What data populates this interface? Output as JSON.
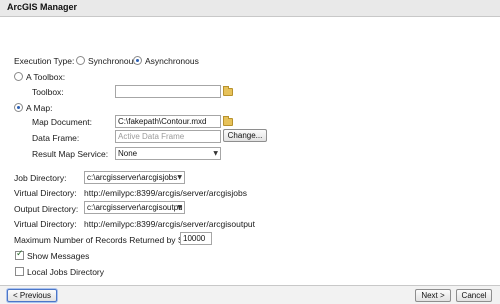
{
  "window": {
    "title": "ArcGIS Manager"
  },
  "execution": {
    "label": "Execution Type:",
    "options": [
      {
        "label": "Synchronous",
        "selected": false
      },
      {
        "label": "Asynchronous",
        "selected": true
      }
    ]
  },
  "toolbox": {
    "radio_label": "A Toolbox:",
    "field_label": "Toolbox:",
    "value": "",
    "selected": false
  },
  "map": {
    "radio_label": "A Map:",
    "selected": true,
    "document_label": "Map Document:",
    "document_value": "C:\\fakepath\\Contour.mxd",
    "data_frame_label": "Data Frame:",
    "data_frame_placeholder": "Active Data Frame",
    "change_button": "Change...",
    "result_service_label": "Result Map Service:",
    "result_service_value": "None"
  },
  "jobs": {
    "job_dir_label": "Job Directory:",
    "job_dir_value": "c:\\arcgisserver\\arcgisjobs",
    "virtual_dir_label": "Virtual Directory:",
    "virtual_dir_value": "http://emilypc:8399/arcgis/server/arcgisjobs",
    "output_dir_label": "Output Directory:",
    "output_dir_value": "c:\\arcgisserver\\arcgisoutpu",
    "output_virtual_label": "Virtual Directory:",
    "output_virtual_value": "http://emilypc:8399/arcgis/server/arcgisoutput"
  },
  "records": {
    "label": "Maximum Number of Records Returned by Server:",
    "value": "10000"
  },
  "options": {
    "show_messages": {
      "label": "Show Messages",
      "checked": true
    },
    "local_jobs": {
      "label": "Local Jobs Directory",
      "checked": false
    }
  },
  "footer": {
    "previous": "< Previous",
    "next": "Next >",
    "cancel": "Cancel"
  }
}
